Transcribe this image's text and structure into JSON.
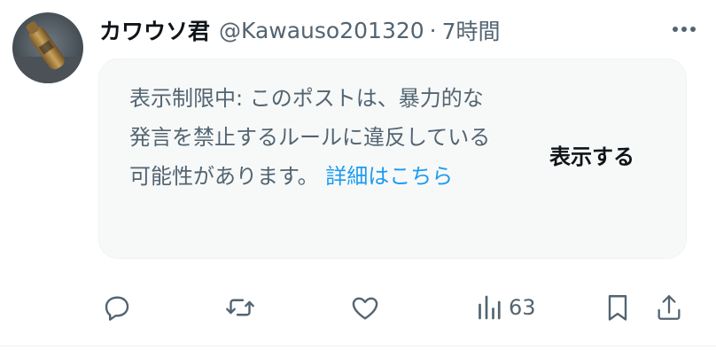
{
  "post": {
    "display_name": "カワウソ君",
    "handle": "@Kawauso201320",
    "separator": "·",
    "time": "7時間",
    "notice": {
      "text": "表示制限中: このポストは、暴力的な発言を禁止するルールに違反している可能性があります。",
      "learn_more": "詳細はこちら",
      "show_label": "表示する"
    },
    "actions": {
      "views": "63",
      "icons": [
        "reply-icon",
        "repost-icon",
        "like-icon",
        "views-icon",
        "bookmark-icon",
        "share-icon"
      ]
    }
  },
  "colors": {
    "text_primary": "#0f1419",
    "text_secondary": "#536471",
    "link": "#1d9bf0",
    "notice_bg": "#f7f9f9"
  }
}
